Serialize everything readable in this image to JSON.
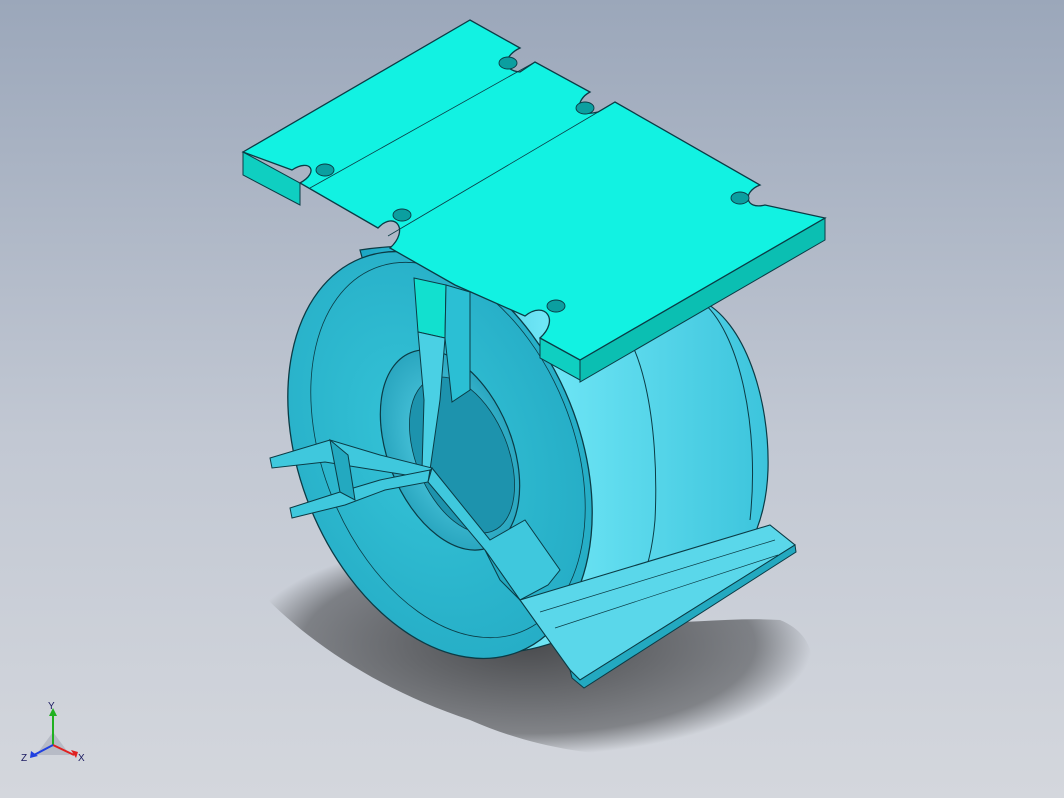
{
  "viewport": {
    "background_top": "#9ba7ba",
    "background_bottom": "#d4d7dd"
  },
  "model": {
    "plate_color": "#12f2e2",
    "plate_side_color": "#0fcfc1",
    "coil_face_color": "#2fb8cc",
    "coil_outer_color": "#4dd6ec",
    "edge_color": "#0b3b45"
  },
  "triad": {
    "x_label": "X",
    "y_label": "Y",
    "z_label": "Z",
    "x_color": "#e02020",
    "y_color": "#20b020",
    "z_color": "#2040e0"
  }
}
